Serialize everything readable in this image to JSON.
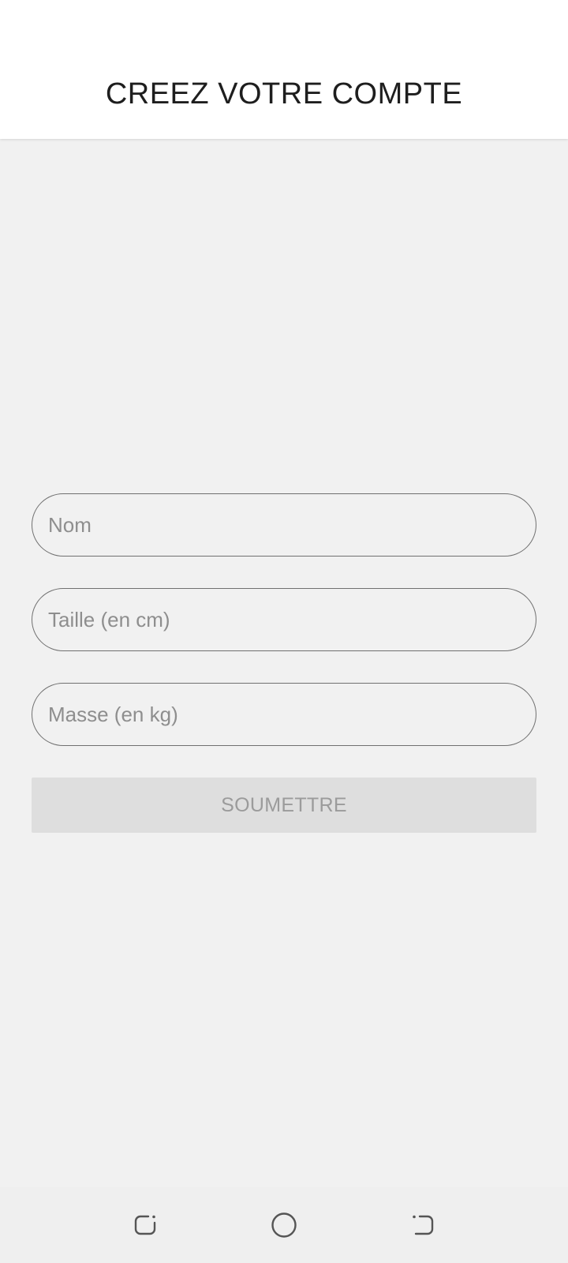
{
  "header": {
    "title": "CREEZ VOTRE COMPTE"
  },
  "form": {
    "nom_placeholder": "Nom",
    "taille_placeholder": "Taille (en cm)",
    "masse_placeholder": "Masse (en kg)",
    "nom_value": "",
    "taille_value": "",
    "masse_value": "",
    "submit_label": "SOUMETTRE"
  },
  "navbar": {
    "icons": [
      "recent-apps-icon",
      "home-icon",
      "back-icon"
    ]
  },
  "colors": {
    "background": "#f1f1f1",
    "header_background": "#ffffff",
    "field_border": "#707070",
    "placeholder": "#8e8e8e",
    "button_background": "#dedede",
    "button_text": "#9b9b9b"
  }
}
